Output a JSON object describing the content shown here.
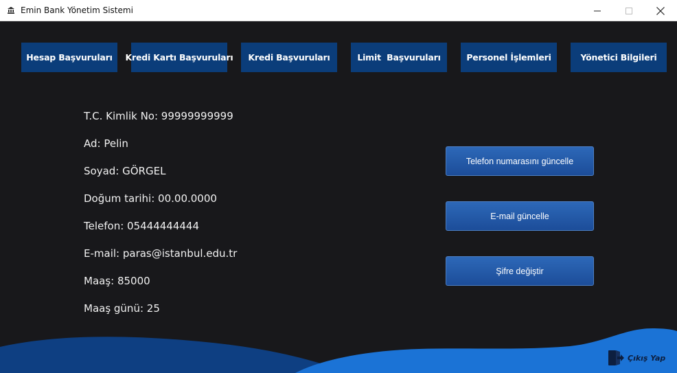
{
  "window": {
    "title": "Emin Bank Yönetim Sistemi",
    "app_icon": "bank-icon",
    "controls": [
      "minimize-icon",
      "maximize-icon",
      "close-icon"
    ]
  },
  "nav": {
    "items": [
      {
        "label": "Hesap Başvuruları"
      },
      {
        "label": "Kredi Kartı Başvuruları"
      },
      {
        "label": "Kredi Başvuruları"
      },
      {
        "label": "Limit  Başvuruları"
      },
      {
        "label": "Personel İşlemleri"
      },
      {
        "label": "Yönetici Bilgileri"
      }
    ]
  },
  "profile": {
    "tc": "T.C. Kimlik No: 99999999999",
    "ad": "Ad: Pelin",
    "soyad": "Soyad: GÖRGEL",
    "dogum": "Doğum tarihi: 00.00.0000",
    "telefon": "Telefon: 05444444444",
    "email": "E-mail: paras@istanbul.edu.tr",
    "maas": "Maaş: 85000",
    "maas_gunu": "Maaş günü: 25"
  },
  "actions": {
    "phone": "Telefon numarasını güncelle",
    "email": "E-mail güncelle",
    "password": "Şifre değiştir"
  },
  "logout": {
    "label": "Çıkış Yap",
    "icon": "logout-icon"
  },
  "colors": {
    "background": "#18181b",
    "nav_button": "#0b3d7a",
    "action_button": "#2d68b8",
    "wave_dark": "#0e3f82",
    "wave_light": "#1b73d6"
  }
}
